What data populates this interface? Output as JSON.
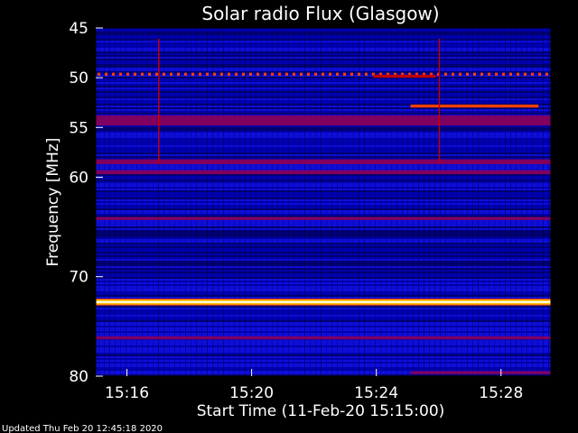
{
  "chart_data": {
    "type": "heatmap",
    "title": "Solar radio Flux (Glasgow)",
    "xlabel": "Start Time (11-Feb-20 15:15:00)",
    "ylabel": "Frequency [MHz]",
    "x_ticks": [
      {
        "label": "15:16",
        "minutes": 1
      },
      {
        "label": "15:20",
        "minutes": 5
      },
      {
        "label": "15:24",
        "minutes": 9
      },
      {
        "label": "15:28",
        "minutes": 13
      }
    ],
    "x_range_minutes": [
      0,
      14.6
    ],
    "y_ticks": [
      45,
      50,
      55,
      60,
      70,
      80
    ],
    "y_range_mhz": [
      45,
      80
    ],
    "colormap": [
      "#000040",
      "#0000b0",
      "#1a1aff",
      "#800060",
      "#c00000",
      "#ff4000",
      "#ffc000",
      "#ffffff"
    ],
    "background_level": "blue",
    "bands": [
      {
        "freq_mhz": [
          53.8,
          54.8
        ],
        "level": "dark-red"
      },
      {
        "freq_mhz": [
          58.2,
          58.7
        ],
        "level": "dark-red"
      },
      {
        "freq_mhz": [
          59.3,
          59.7
        ],
        "level": "dark-red"
      },
      {
        "freq_mhz": [
          64.0,
          64.3
        ],
        "level": "dark-red"
      },
      {
        "freq_mhz": [
          72.3,
          72.8
        ],
        "level": "saturated"
      },
      {
        "freq_mhz": [
          76.0,
          76.3
        ],
        "level": "dark-red"
      }
    ],
    "events": [
      {
        "time_minutes": [
          0,
          14.6
        ],
        "freq_mhz": [
          49.5,
          49.8
        ],
        "level": "dotted-orange"
      },
      {
        "time_minutes": [
          8.9,
          10.9
        ],
        "freq_mhz": [
          49.7,
          50.0
        ],
        "level": "red"
      },
      {
        "time_minutes": [
          10.1,
          14.2
        ],
        "freq_mhz": [
          52.7,
          53.0
        ],
        "level": "orange"
      },
      {
        "time_minutes": [
          10.1,
          14.6
        ],
        "freq_mhz": [
          79.5,
          79.8
        ],
        "level": "dark-red"
      }
    ],
    "spikes_minutes": [
      2.0,
      11.0
    ]
  },
  "footer": {
    "updated": "Updated Thu Feb 20 12:45:18 2020"
  }
}
